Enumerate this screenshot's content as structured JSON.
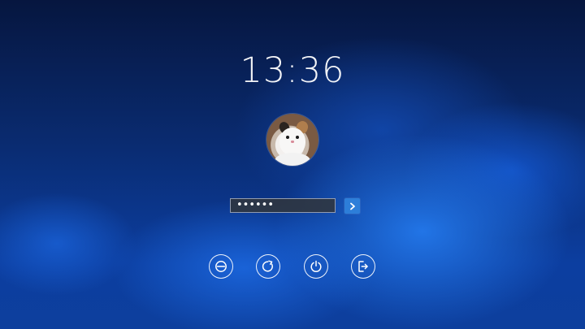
{
  "lock_screen": {
    "time": "13:36",
    "avatar": {
      "subject": "cat",
      "icon": "user-avatar"
    },
    "password": {
      "value": "••••••",
      "submit_icon": "chevron-right-icon"
    },
    "actions": [
      {
        "icon": "suspend-icon"
      },
      {
        "icon": "reboot-icon"
      },
      {
        "icon": "power-icon"
      },
      {
        "icon": "logout-icon"
      }
    ],
    "colors": {
      "background_dark": "#06163f",
      "background_blue": "#2378eb",
      "accent": "#2d7ed9",
      "text": "#ffffff",
      "field_bg": "#30363e"
    }
  }
}
